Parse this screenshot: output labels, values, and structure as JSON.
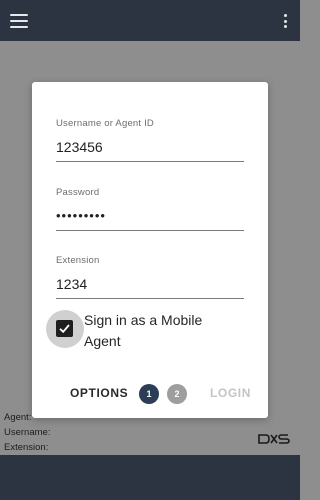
{
  "topbar": {
    "menu_icon": "hamburger-menu-icon",
    "more_icon": "more-vertical-icon"
  },
  "background": {
    "info_lines": [
      "Agent:",
      "Username:",
      "Extension:"
    ],
    "logo_icon": "brand-logo"
  },
  "login": {
    "username": {
      "label": "Username or Agent ID",
      "value": "123456"
    },
    "password": {
      "label": "Password",
      "value": "•••••••••"
    },
    "extension": {
      "label": "Extension",
      "value": "1234"
    },
    "mobile_checkbox": {
      "label": "Sign in as a Mobile Agent",
      "checked": true
    },
    "actions": {
      "options_label": "OPTIONS",
      "steps": [
        "1",
        "2"
      ],
      "current_step": 1,
      "login_label": "LOGIN"
    }
  },
  "colors": {
    "header": "#2b3440",
    "overlay": "#8e8e8e",
    "step_active": "#2b3e55",
    "step_inactive": "#9e9e9e",
    "login_disabled": "#c4c4c4"
  }
}
